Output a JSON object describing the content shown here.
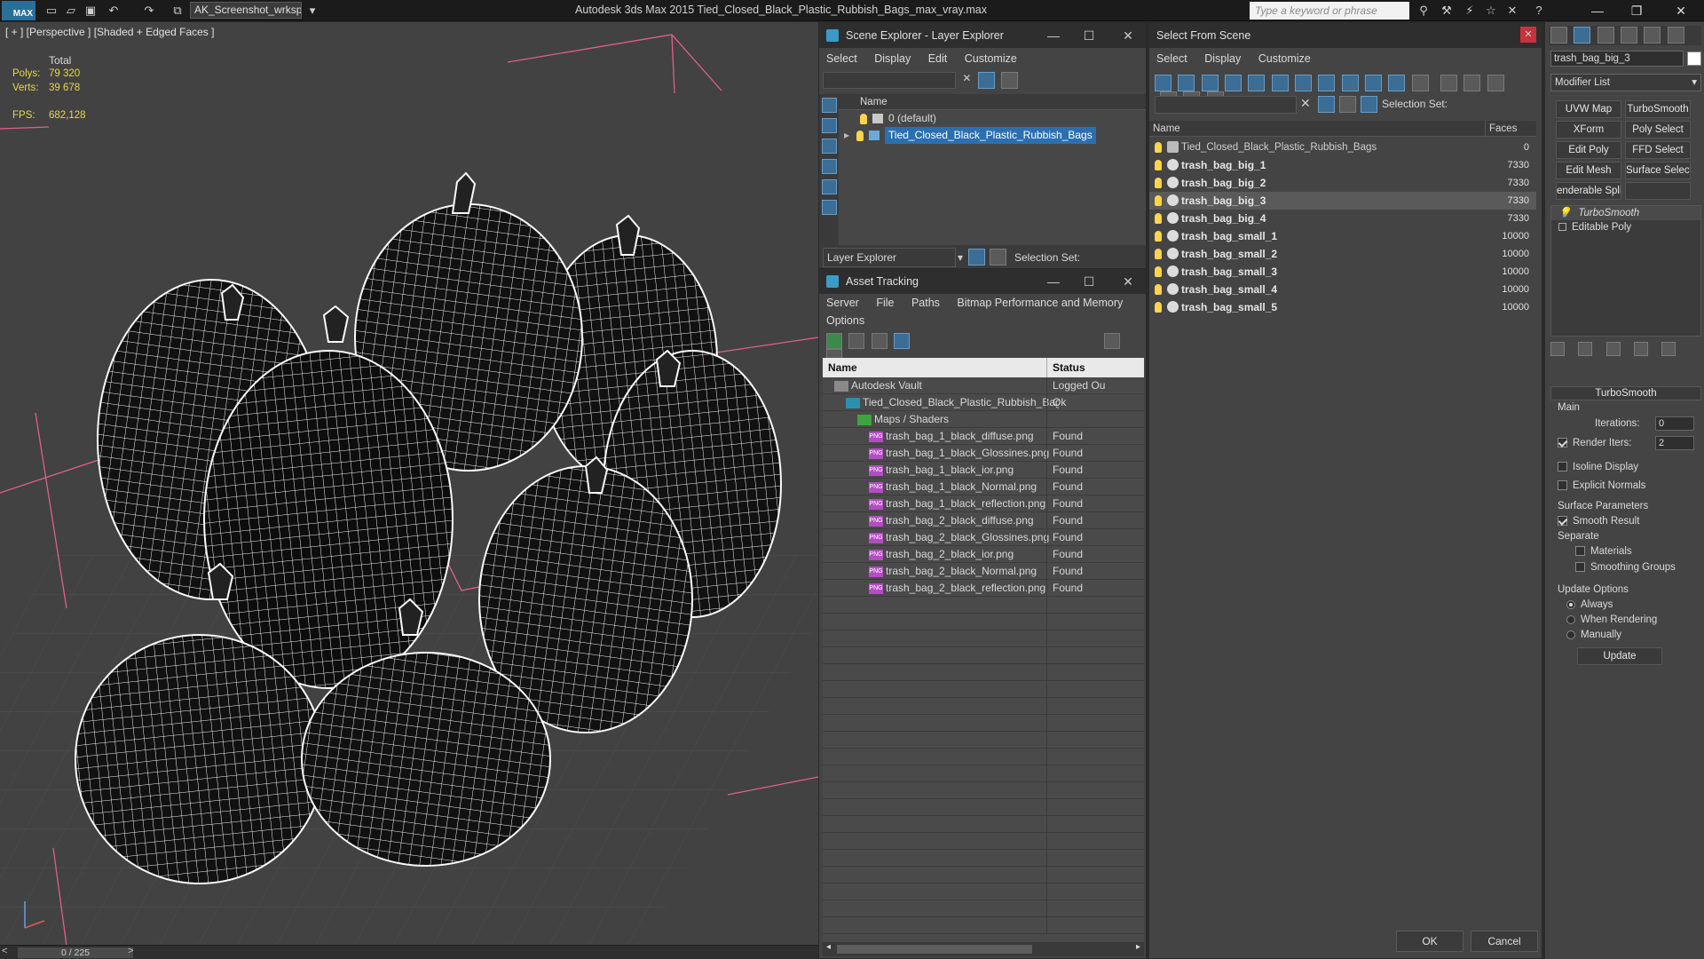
{
  "titlebar": {
    "logo": "MAX",
    "workspace": "AK_Screenshot_wrksp",
    "app_title": "Autodesk 3ds Max  2015    Tied_Closed_Black_Plastic_Rubbish_Bags_max_vray.max",
    "search_placeholder": "Type a keyword or phrase",
    "min": "—",
    "max": "❐",
    "close": "✕"
  },
  "viewport": {
    "label": "[ + ] [Perspective ] [Shaded + Edged Faces ]",
    "total": "Total",
    "polys_label": "Polys:",
    "polys": "79 320",
    "verts_label": "Verts:",
    "verts": "39 678",
    "fps_label": "FPS:",
    "fps": "682,128",
    "time": "0 / 225",
    "prev": "<",
    "next": ">"
  },
  "scene_explorer": {
    "title": "Scene Explorer - Layer Explorer",
    "menu": [
      "Select",
      "Display",
      "Edit",
      "Customize"
    ],
    "col_name": "Name",
    "layers": [
      {
        "name": "0 (default)",
        "selected": false
      },
      {
        "name": "Tied_Closed_Black_Plastic_Rubbish_Bags",
        "selected": true
      }
    ],
    "bottom_label": "Layer Explorer",
    "selection_set": "Selection Set:"
  },
  "asset_tracking": {
    "title": "Asset Tracking",
    "menu": [
      "Server",
      "File",
      "Paths",
      "Bitmap Performance and Memory"
    ],
    "menu2": "Options",
    "col_name": "Name",
    "col_status": "Status",
    "rows": [
      {
        "name": "Autodesk Vault",
        "status": "Logged Ou",
        "indent": 1,
        "type": "vault"
      },
      {
        "name": "Tied_Closed_Black_Plastic_Rubbish_Bags_m...",
        "status": "Ok",
        "indent": 2,
        "type": "max"
      },
      {
        "name": "Maps / Shaders",
        "status": "",
        "indent": 3,
        "type": "folder"
      },
      {
        "name": "trash_bag_1_black_diffuse.png",
        "status": "Found",
        "indent": 4,
        "type": "png"
      },
      {
        "name": "trash_bag_1_black_Glossines.png",
        "status": "Found",
        "indent": 4,
        "type": "png"
      },
      {
        "name": "trash_bag_1_black_ior.png",
        "status": "Found",
        "indent": 4,
        "type": "png"
      },
      {
        "name": "trash_bag_1_black_Normal.png",
        "status": "Found",
        "indent": 4,
        "type": "png"
      },
      {
        "name": "trash_bag_1_black_reflection.png",
        "status": "Found",
        "indent": 4,
        "type": "png"
      },
      {
        "name": "trash_bag_2_black_diffuse.png",
        "status": "Found",
        "indent": 4,
        "type": "png"
      },
      {
        "name": "trash_bag_2_black_Glossines.png",
        "status": "Found",
        "indent": 4,
        "type": "png"
      },
      {
        "name": "trash_bag_2_black_ior.png",
        "status": "Found",
        "indent": 4,
        "type": "png"
      },
      {
        "name": "trash_bag_2_black_Normal.png",
        "status": "Found",
        "indent": 4,
        "type": "png"
      },
      {
        "name": "trash_bag_2_black_reflection.png",
        "status": "Found",
        "indent": 4,
        "type": "png"
      }
    ]
  },
  "select_from_scene": {
    "title": "Select From Scene",
    "menu": [
      "Select",
      "Display",
      "Customize"
    ],
    "selection_set": "Selection Set:",
    "col_name": "Name",
    "col_faces": "Faces",
    "rows": [
      {
        "name": "Tied_Closed_Black_Plastic_Rubbish_Bags",
        "faces": "0",
        "group": true,
        "highlight": false
      },
      {
        "name": "trash_bag_big_1",
        "faces": "7330",
        "group": false,
        "highlight": false
      },
      {
        "name": "trash_bag_big_2",
        "faces": "7330",
        "group": false,
        "highlight": false
      },
      {
        "name": "trash_bag_big_3",
        "faces": "7330",
        "group": false,
        "highlight": true
      },
      {
        "name": "trash_bag_big_4",
        "faces": "7330",
        "group": false,
        "highlight": false
      },
      {
        "name": "trash_bag_small_1",
        "faces": "10000",
        "group": false,
        "highlight": false
      },
      {
        "name": "trash_bag_small_2",
        "faces": "10000",
        "group": false,
        "highlight": false
      },
      {
        "name": "trash_bag_small_3",
        "faces": "10000",
        "group": false,
        "highlight": false
      },
      {
        "name": "trash_bag_small_4",
        "faces": "10000",
        "group": false,
        "highlight": false
      },
      {
        "name": "trash_bag_small_5",
        "faces": "10000",
        "group": false,
        "highlight": false
      }
    ],
    "ok": "OK",
    "cancel": "Cancel"
  },
  "command_panel": {
    "object_name": "trash_bag_big_3",
    "modifier_list": "Modifier List",
    "buttons": [
      "UVW Map",
      "TurboSmooth",
      "XForm",
      "Poly Select",
      "Edit Poly",
      "FFD Select",
      "Edit Mesh",
      "Surface Select",
      "enderable Splir",
      ""
    ],
    "stack": [
      {
        "name": "TurboSmooth",
        "italic": true
      },
      {
        "name": "Editable Poly",
        "italic": false
      }
    ],
    "rollout_title": "TurboSmooth",
    "main": "Main",
    "iterations_label": "Iterations:",
    "iterations": "0",
    "render_iters_label": "Render Iters:",
    "render_iters": "2",
    "isoline": "Isoline Display",
    "explicit_normals": "Explicit Normals",
    "surface_params": "Surface Parameters",
    "smooth_result": "Smooth Result",
    "separate": "Separate",
    "materials": "Materials",
    "smoothing_groups": "Smoothing Groups",
    "update_options": "Update Options",
    "always": "Always",
    "when_rendering": "When Rendering",
    "manually": "Manually",
    "update": "Update"
  },
  "colors": {
    "accent": "#2a6fb0",
    "stat_yellow": "#e8d84a",
    "wire": "#ffffff",
    "axis_pink": "#e0608a"
  }
}
